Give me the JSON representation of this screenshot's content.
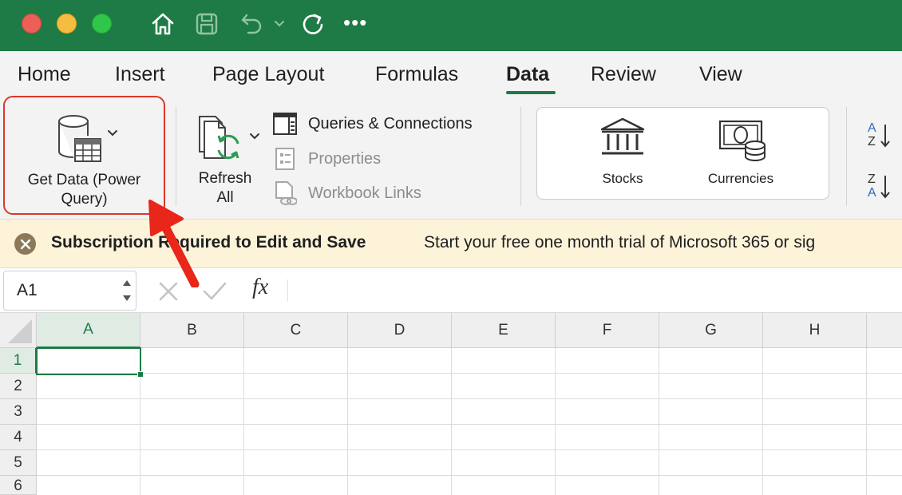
{
  "colors": {
    "title_bar": "#1e7b45",
    "accent": "#1e7b45",
    "highlight_border": "#d9392a",
    "message_bar": "#fcf3d9",
    "arrow": "#e8261a"
  },
  "titlebar": {
    "icons": [
      "home-icon",
      "save-icon",
      "undo-icon",
      "undo-dropdown-icon",
      "redo-icon",
      "more-icon"
    ],
    "more_label": "•••"
  },
  "tabs": [
    {
      "label": "Home"
    },
    {
      "label": "Insert"
    },
    {
      "label": "Page Layout"
    },
    {
      "label": "Formulas"
    },
    {
      "label": "Data",
      "active": true
    },
    {
      "label": "Review"
    },
    {
      "label": "View"
    }
  ],
  "ribbon": {
    "get_data": {
      "line1": "Get Data (Power",
      "line2": "Query)"
    },
    "refresh": {
      "line1": "Refresh",
      "line2": "All"
    },
    "queries_connections": "Queries & Connections",
    "properties": "Properties",
    "workbook_links": "Workbook Links",
    "stocks": "Stocks",
    "currencies": "Currencies",
    "sort_az": {
      "top": "A",
      "bottom": "Z"
    },
    "sort_za": {
      "top": "Z",
      "bottom": "A"
    }
  },
  "message_bar": {
    "title": "Subscription Required to Edit and Save",
    "text": "Start your free one month trial of Microsoft 365 or sig"
  },
  "formula_bar": {
    "name_box": "A1",
    "fx": "fx",
    "formula": ""
  },
  "grid": {
    "columns": [
      "A",
      "B",
      "C",
      "D",
      "E",
      "F",
      "G",
      "H"
    ],
    "rows": [
      "1",
      "2",
      "3",
      "4",
      "5",
      "6"
    ],
    "selected": "A1"
  }
}
